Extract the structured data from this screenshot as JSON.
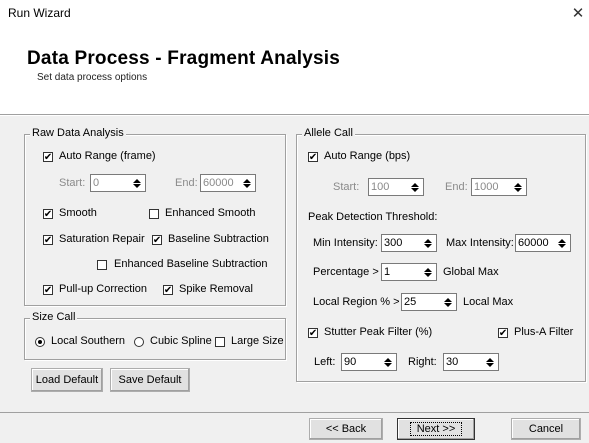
{
  "window": {
    "title": "Run Wizard"
  },
  "header": {
    "title": "Data Process - Fragment Analysis",
    "subtitle": "Set data process options"
  },
  "raw": {
    "title": "Raw Data Analysis",
    "auto_range": "Auto Range (frame)",
    "start_label": "Start:",
    "start_value": "0",
    "end_label": "End:",
    "end_value": "60000",
    "smooth": "Smooth",
    "enhanced_smooth": "Enhanced Smooth",
    "saturation_repair": "Saturation Repair",
    "baseline_subtraction": "Baseline Subtraction",
    "enhanced_baseline": "Enhanced Baseline Subtraction",
    "pullup": "Pull-up Correction",
    "spike": "Spike Removal"
  },
  "size": {
    "title": "Size Call",
    "local_southern": "Local Southern",
    "cubic_spline": "Cubic Spline",
    "large_size": "Large Size"
  },
  "buttons": {
    "load_default": "Load Default",
    "save_default": "Save Default",
    "back": "<< Back",
    "next": "Next >>",
    "cancel": "Cancel"
  },
  "allele": {
    "title": "Allele Call",
    "auto_range": "Auto Range (bps)",
    "start_label": "Start:",
    "start_value": "100",
    "end_label": "End:",
    "end_value": "1000",
    "peak_threshold": "Peak Detection Threshold:",
    "min_label": "Min Intensity:",
    "min_value": "300",
    "max_label": "Max Intensity:",
    "max_value": "60000",
    "pct_label": "Percentage >",
    "pct_value": "1",
    "global_max": "Global Max",
    "local_label": "Local Region % >",
    "local_value": "25",
    "local_max": "Local Max",
    "stutter": "Stutter Peak Filter (%)",
    "plus_a": "Plus-A Filter",
    "left_label": "Left:",
    "left_value": "90",
    "right_label": "Right:",
    "right_value": "30"
  }
}
